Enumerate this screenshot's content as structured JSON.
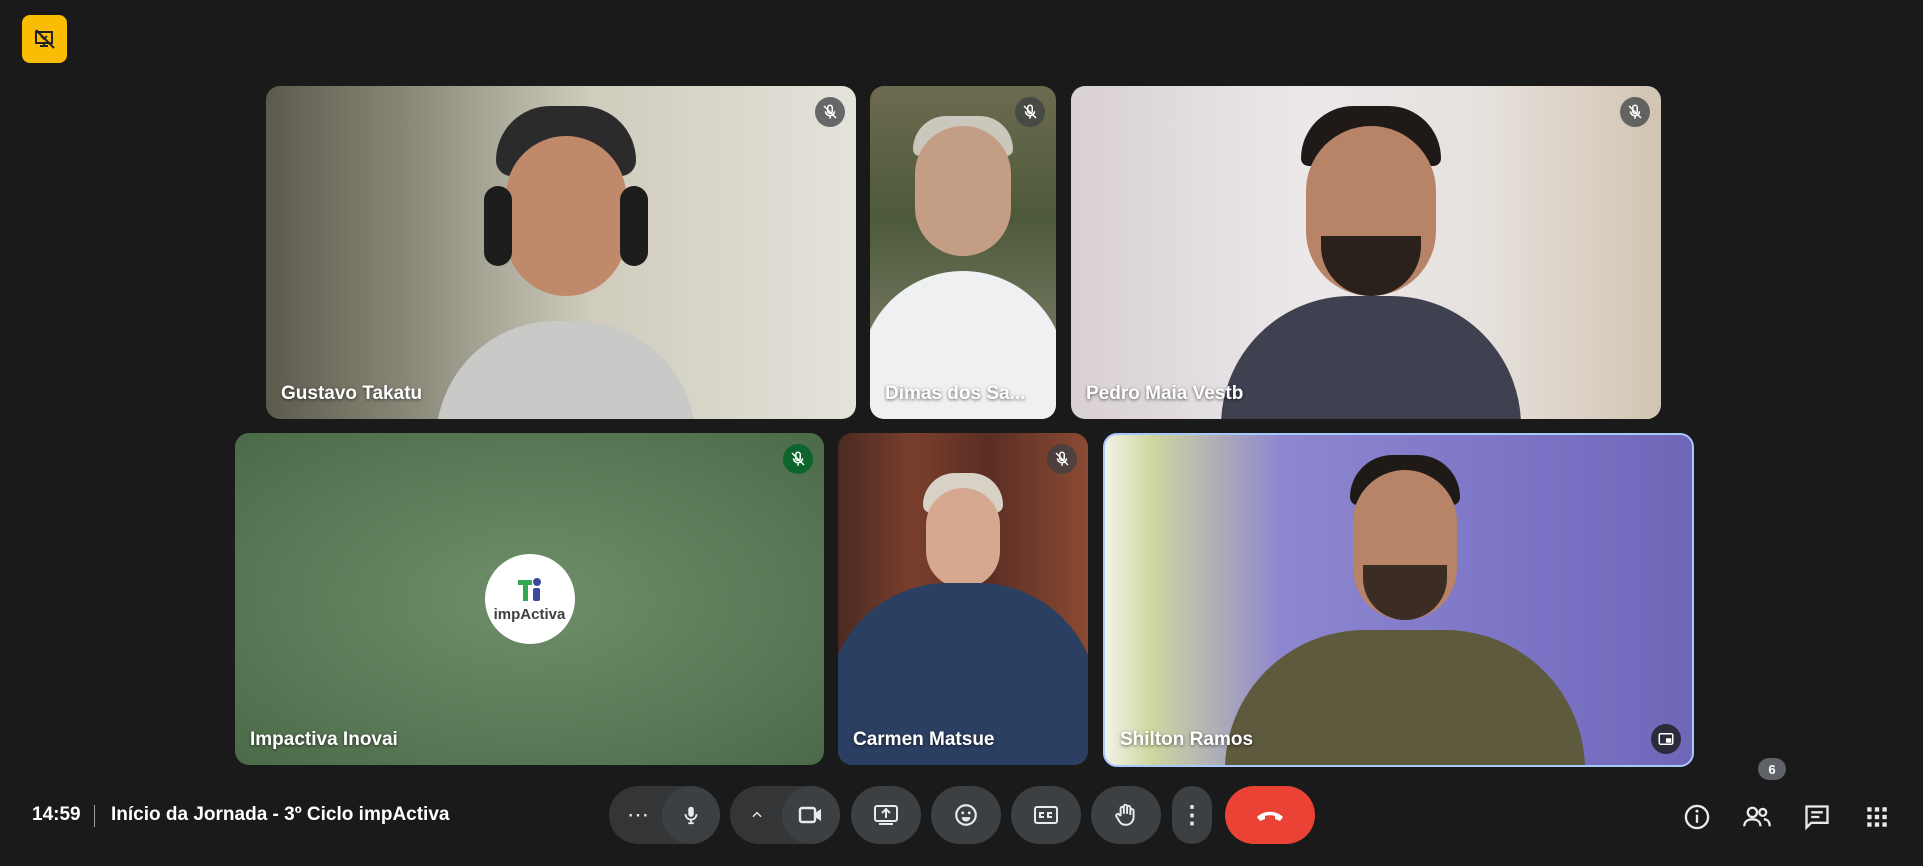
{
  "top_badge": {
    "icon": "presentation-off-icon"
  },
  "tiles": [
    {
      "name": "Gustavo Takatu",
      "mic": "muted"
    },
    {
      "name": "Dimas dos Sa...",
      "mic": "muted"
    },
    {
      "name": "Pedro Maia Vestb",
      "mic": "muted"
    },
    {
      "name": "Impactiva Inovai",
      "mic": "muted",
      "avatar_text": "impActiva"
    },
    {
      "name": "Carmen Matsue",
      "mic": "muted"
    },
    {
      "name": "Shilton Ramos",
      "mic": "active"
    }
  ],
  "footer": {
    "time": "14:59",
    "meeting_title": "Início da Jornada - 3º Ciclo impActiva"
  },
  "controls": {
    "more_glyph": "⋯",
    "expand_glyph": "^",
    "vertical_dots": "⋮"
  },
  "right_panel": {
    "participants_count": "6"
  },
  "colors": {
    "accent_badge": "#fbbc04",
    "end_call": "#ea4335",
    "active_speaker_border": "#a8c7fa"
  }
}
